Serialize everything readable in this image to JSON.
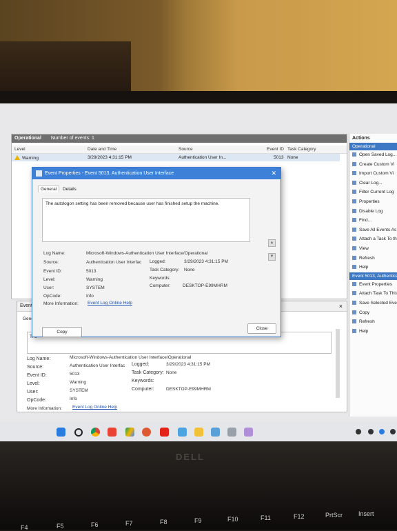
{
  "main_panel": {
    "header_title": "Operational",
    "header_count": "Number of events: 1",
    "columns": [
      "Level",
      "Date and Time",
      "Source",
      "Event ID",
      "Task Category"
    ],
    "row": {
      "level": "Warning",
      "datetime": "3/29/2023 4:31:15 PM",
      "source": "Authentication User In...",
      "event_id": "5013",
      "task_category": "None"
    }
  },
  "actions": {
    "title": "Actions",
    "section1": "Operational",
    "items1": [
      "Open Saved Log...",
      "Create Custom Vi",
      "Import Custom Vi",
      "Clear Log...",
      "Filter Current Log",
      "Properties",
      "Disable Log",
      "Find...",
      "Save All Events As",
      "Attach a Task To th",
      "View",
      "Refresh",
      "Help"
    ],
    "section2": "Event 5013, Authenticat",
    "items2": [
      "Event Properties",
      "Attach Task To This",
      "Save Selected Even",
      "Copy",
      "Refresh",
      "Help"
    ]
  },
  "bottom_panel": {
    "title": "Event 5",
    "tab": "Genera",
    "desc_snippet": "The",
    "close_glyph": "×",
    "log_name_label": "Log Name:",
    "log_name": "Microsoft-Windows-Authentication User Interface/Operational",
    "source_label": "Source:",
    "source": "Authentication User Interfac",
    "logged_label": "Logged:",
    "logged": "3/29/2023 4:31:15 PM",
    "event_id_label": "Event ID:",
    "event_id": "5013",
    "task_cat_label": "Task Category:",
    "task_cat": "None",
    "level_label": "Level:",
    "level": "Warning",
    "keywords_label": "Keywords:",
    "user_label": "User:",
    "user": "SYSTEM",
    "computer_label": "Computer:",
    "computer": "DESKTOP-E99MHRM",
    "opcode_label": "OpCode:",
    "opcode": "Info",
    "more_label": "More Information:",
    "more_link": "Event Log Online Help"
  },
  "dialog": {
    "title": "Event Properties - Event 5013, Authentication User Interface",
    "close_glyph": "✕",
    "tab_general": "General",
    "tab_details": "Details",
    "description": "The autologon setting has been removed because user has finished setup the machine.",
    "log_name_label": "Log Name:",
    "log_name": "Microsoft-Windows-Authentication User Interface/Operational",
    "source_label": "Source:",
    "source": "Authentication User Interfac",
    "logged_label": "Logged:",
    "logged": "3/29/2023 4:31:15 PM",
    "event_id_label": "Event ID:",
    "event_id": "5013",
    "task_cat_label": "Task Category:",
    "task_cat": "None",
    "level_label": "Level:",
    "level": "Warning",
    "keywords_label": "Keywords:",
    "user_label": "User:",
    "user": "SYSTEM",
    "computer_label": "Computer:",
    "computer": "DESKTOP-E99MHRM",
    "opcode_label": "OpCode:",
    "opcode": "Info",
    "more_label": "More Information:",
    "more_link": "Event Log Online Help",
    "copy_button": "Copy",
    "close_button": "Close"
  },
  "taskbar": {
    "icons": [
      "windows-start-icon",
      "search-icon",
      "chrome-icon",
      "gmail-icon",
      "google-drive-icon",
      "app-icon",
      "duckduckgo-icon",
      "youtube-icon",
      "app-icon",
      "file-explorer-icon",
      "event-viewer-icon",
      "app-icon",
      "app-icon"
    ]
  },
  "keyboard": {
    "brand": "DELL",
    "keys": [
      "F4",
      "F5",
      "F6",
      "F7",
      "F8",
      "F9",
      "F10",
      "F11",
      "F12",
      "PrtScr",
      "Insert"
    ]
  },
  "colors": {
    "accent": "#3c80d8",
    "warning": "#e8b400",
    "header_bg": "#6f6f6f"
  }
}
